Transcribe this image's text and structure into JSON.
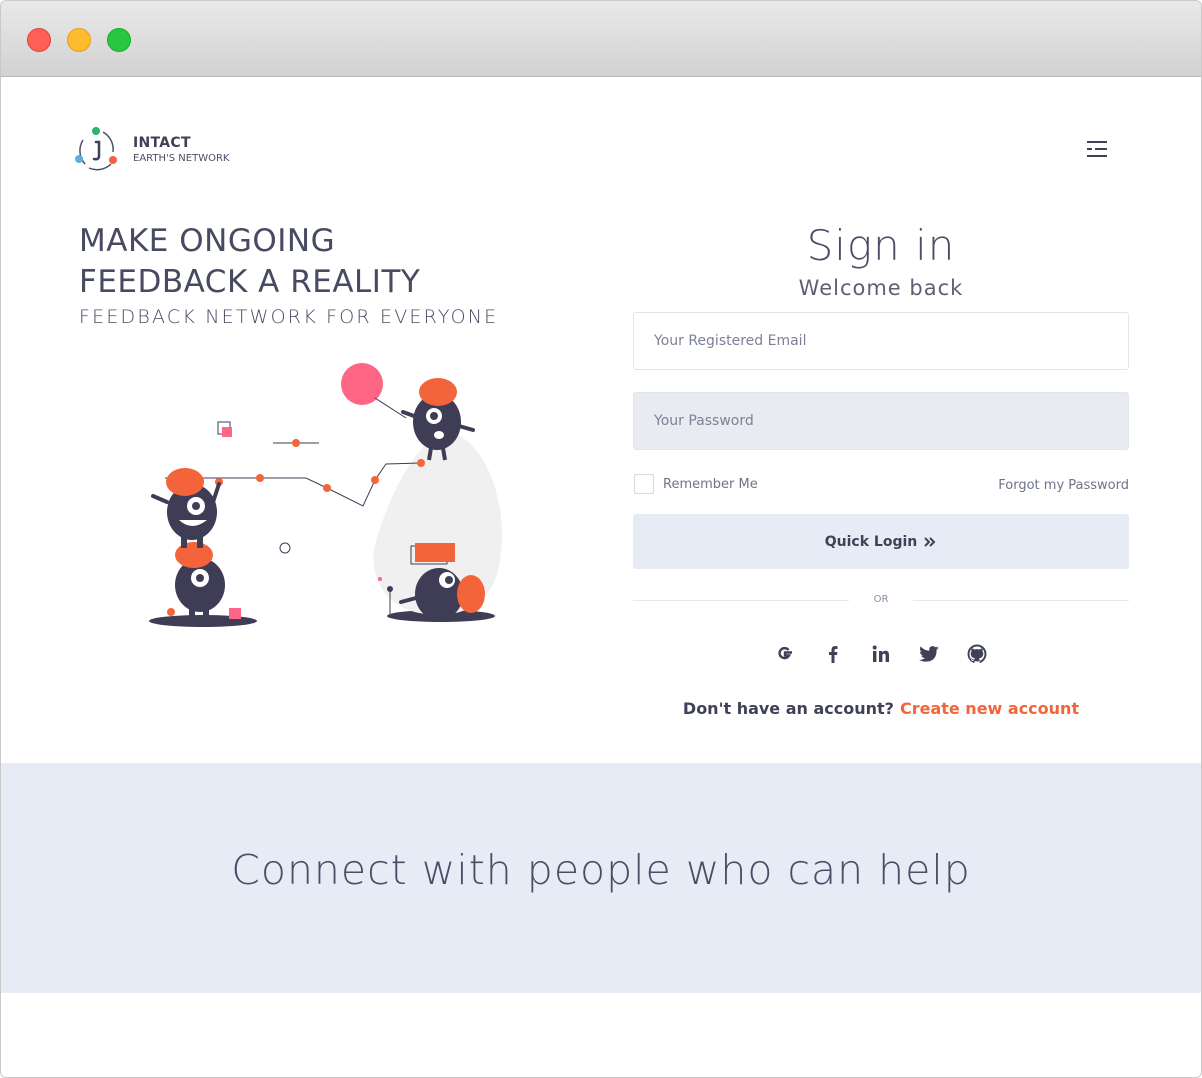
{
  "brand": {
    "name": "INTACT",
    "subtitle": "EARTH'S NETWORK"
  },
  "hero": {
    "headline_line1": "MAKE ONGOING",
    "headline_line2": "FEEDBACK A REALITY",
    "tagline": "FEEDBACK NETWORK FOR EVERYONE"
  },
  "signin": {
    "title": "Sign in",
    "subtitle": "Welcome back",
    "email_placeholder": "Your Registered Email",
    "password_placeholder": "Your Password",
    "remember_label": "Remember Me",
    "forgot_label": "Forgot my Password",
    "login_label": "Quick Login",
    "or_label": "OR",
    "social_icons": [
      "google-icon",
      "facebook-icon",
      "linkedin-icon",
      "twitter-icon",
      "github-icon"
    ],
    "no_account_text": "Don't have an account?",
    "create_account_label": "Create new account"
  },
  "banner": {
    "text": "Connect with people who can help"
  },
  "colors": {
    "accent": "#f4643b",
    "text_dark": "#3f4257",
    "banner_bg": "#e6ebf5"
  }
}
